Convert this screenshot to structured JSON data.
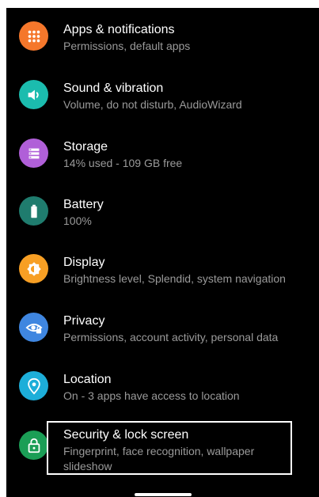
{
  "settings": {
    "items": [
      {
        "title": "Apps & notifications",
        "subtitle": "Permissions, default apps",
        "icon": "apps-grid-icon",
        "color": "#F5772B"
      },
      {
        "title": "Sound & vibration",
        "subtitle": "Volume, do not disturb, AudioWizard",
        "icon": "speaker-icon",
        "color": "#1BBCAE"
      },
      {
        "title": "Storage",
        "subtitle": "14% used - 109 GB free",
        "icon": "storage-icon",
        "color": "#B05FD8"
      },
      {
        "title": "Battery",
        "subtitle": "100%",
        "icon": "battery-icon",
        "color": "#1F7C6E"
      },
      {
        "title": "Display",
        "subtitle": "Brightness level, Splendid, system navigation",
        "icon": "brightness-icon",
        "color": "#F79F24"
      },
      {
        "title": "Privacy",
        "subtitle": "Permissions, account activity, personal data",
        "icon": "privacy-eye-lock-icon",
        "color": "#3F86E0"
      },
      {
        "title": "Location",
        "subtitle": "On - 3 apps have access to location",
        "icon": "location-pin-icon",
        "color": "#1DAED9"
      },
      {
        "title": "Security & lock screen",
        "subtitle": "Fingerprint, face recognition, wallpaper slideshow",
        "icon": "padlock-icon",
        "color": "#1B9E56"
      }
    ]
  }
}
